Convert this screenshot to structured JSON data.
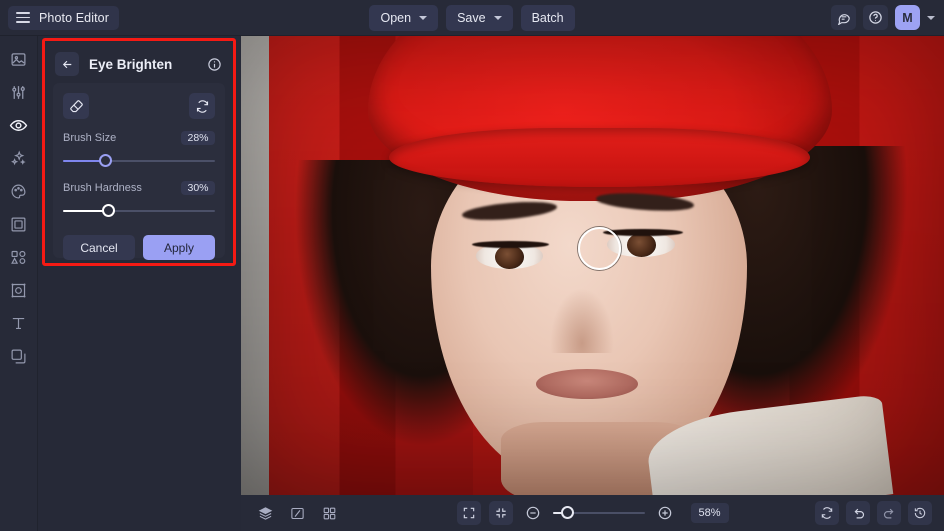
{
  "app": {
    "title": "Photo Editor",
    "accent_color": "#9aa0f3",
    "bg_color": "#262937",
    "annotation_color": "#f51a14"
  },
  "topbar": {
    "menu_icon": "hamburger-icon",
    "open_label": "Open",
    "save_label": "Save",
    "batch_label": "Batch",
    "feedback_icon": "comment-icon",
    "help_icon": "help-circle-icon",
    "avatar_initial": "M",
    "account_caret_icon": "chevron-down-icon"
  },
  "sidebar": {
    "items": [
      {
        "name": "image",
        "icon": "image-icon",
        "active": false
      },
      {
        "name": "adjust",
        "icon": "sliders-icon",
        "active": false
      },
      {
        "name": "retouch",
        "icon": "eye-icon",
        "active": true
      },
      {
        "name": "effects",
        "icon": "sparkles-icon",
        "active": false
      },
      {
        "name": "color",
        "icon": "palette-icon",
        "active": false
      },
      {
        "name": "frames",
        "icon": "frame-icon",
        "active": false
      },
      {
        "name": "shapes",
        "icon": "shapes-icon",
        "active": false
      },
      {
        "name": "focus",
        "icon": "focus-icon",
        "active": false
      },
      {
        "name": "text",
        "icon": "text-t-icon",
        "active": false
      },
      {
        "name": "layers",
        "icon": "layers-overlap-icon",
        "active": false
      }
    ]
  },
  "panel": {
    "back_icon": "arrow-left-icon",
    "title": "Eye Brighten",
    "info_icon": "info-circle-icon",
    "eraser_icon": "eraser-icon",
    "reset_icon": "reset-rotate-icon",
    "sliders": [
      {
        "label": "Brush Size",
        "value": "28%",
        "percent": 28,
        "fill": "accent"
      },
      {
        "label": "Brush Hardness",
        "value": "30%",
        "percent": 30,
        "fill": "white"
      }
    ],
    "cancel_label": "Cancel",
    "apply_label": "Apply"
  },
  "bottombar": {
    "layers_icon": "stack-icon",
    "compare_icon": "compare-split-icon",
    "grid_icon": "grid-four-icon",
    "fit_icon": "fit-screen-icon",
    "fullscreen_icon": "collapse-arrows-icon",
    "zoom_out_icon": "minus-circle-icon",
    "zoom_in_icon": "plus-circle-icon",
    "zoom_value": "58%",
    "zoom_percent": 12,
    "reset_icon": "reset-rotate-icon",
    "undo_icon": "undo-arrow-icon",
    "redo_icon": "redo-arrow-icon",
    "history_icon": "history-clock-icon"
  },
  "canvas": {
    "description": "portrait-photo-woman-red-beanie",
    "brush_cursor": "circle-brush-cursor"
  }
}
